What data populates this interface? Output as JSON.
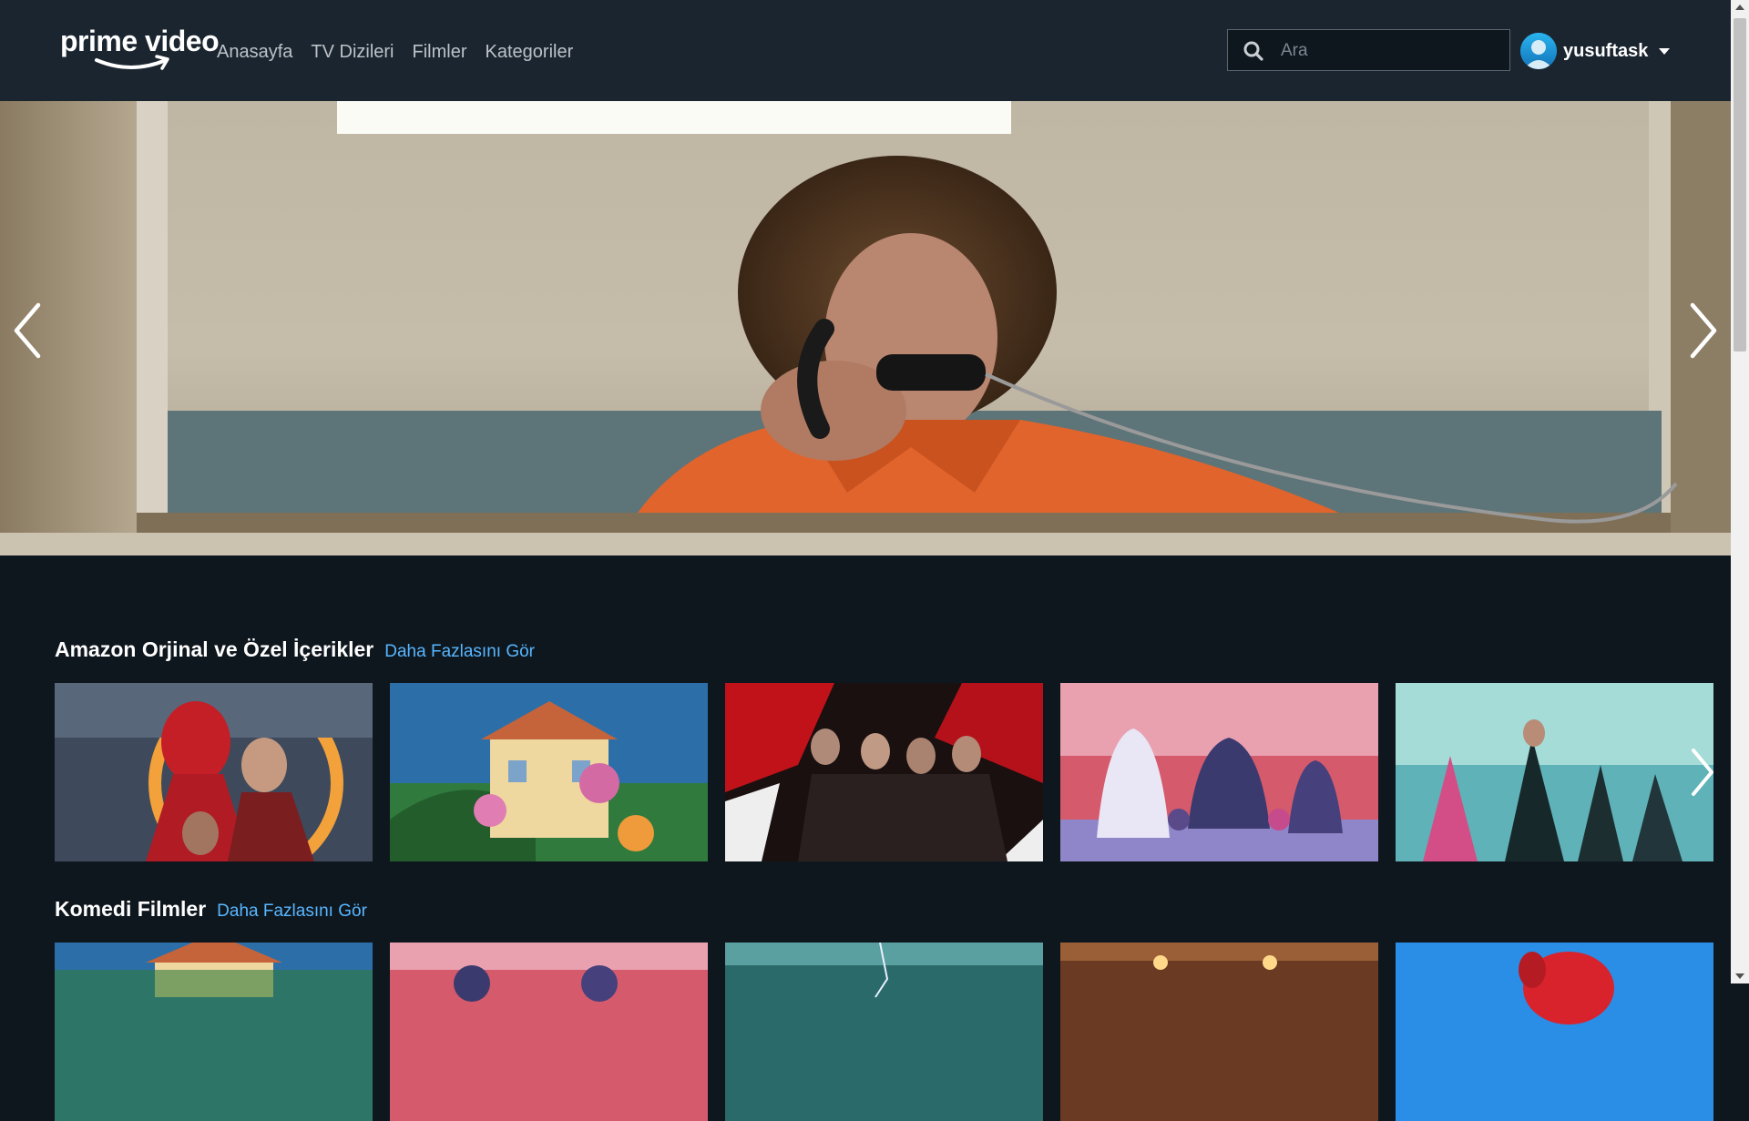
{
  "header": {
    "logo_text": "prime video",
    "nav": [
      "Anasayfa",
      "TV Dizileri",
      "Filmler",
      "Kategoriler"
    ],
    "search_placeholder": "Ara",
    "username": "yusuftask"
  },
  "hero": {
    "scene": "hero-banner-image"
  },
  "rows": [
    {
      "title": "Amazon Orjinal ve Özel İçerikler",
      "more": "Daha Fazlasını Gör",
      "cards": [
        "poster-spiderman",
        "poster-encanto",
        "poster-resident-evil",
        "poster-sing-2",
        "poster-matrix"
      ]
    },
    {
      "title": "Komedi Filmler",
      "more": "Daha Fazlasını Gör",
      "cards": [
        "poster-encanto",
        "poster-sing-2",
        "poster-fantasy",
        "poster-hall",
        "poster-clifford"
      ]
    }
  ],
  "colors": {
    "header_bg": "#1b2530",
    "page_bg": "#0f171e",
    "link": "#58b6ff",
    "nav_text": "#bcc2c7"
  }
}
